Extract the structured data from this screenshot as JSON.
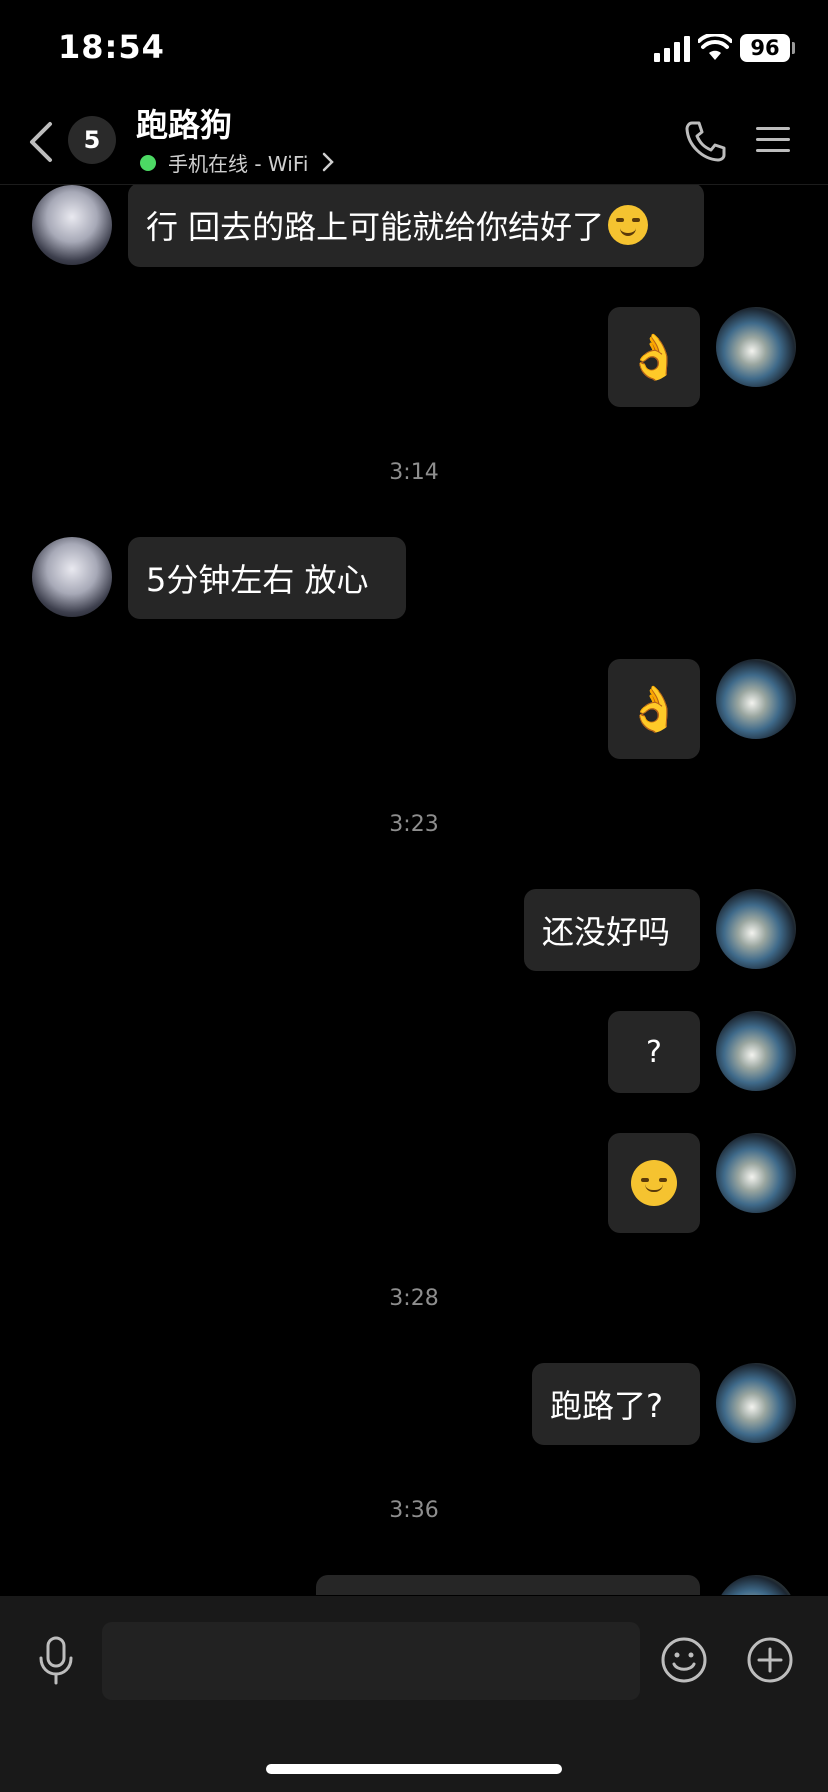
{
  "status_bar": {
    "time": "18:54",
    "battery": "96"
  },
  "header": {
    "back_label": "<",
    "unread_count": "5",
    "title": "跑路狗",
    "online_status": "手机在线 - WiFi"
  },
  "messages": [
    {
      "side": "other",
      "text": "行 回去的路上可能就给你结好了",
      "emoji": "smirk-face"
    },
    {
      "side": "self",
      "emoji": "ok-hand"
    },
    {
      "type": "time",
      "text": "3:14"
    },
    {
      "side": "other",
      "text": "5分钟左右 放心"
    },
    {
      "side": "self",
      "emoji": "ok-hand"
    },
    {
      "type": "time",
      "text": "3:23"
    },
    {
      "side": "self",
      "text": "还没好吗"
    },
    {
      "side": "self",
      "text": "?"
    },
    {
      "side": "self",
      "emoji": "pensive-face"
    },
    {
      "type": "time",
      "text": "3:28"
    },
    {
      "side": "self",
      "text": "跑路了?"
    },
    {
      "type": "time",
      "text": "3:36"
    }
  ],
  "composer": {
    "value": "",
    "placeholder": ""
  },
  "colors": {
    "background": "#000000",
    "bubble": "#262626",
    "online": "#4cd964",
    "timestamp": "#8e8e8e",
    "input_bar": "#191919"
  },
  "icons": [
    "back-chevron-icon",
    "phone-icon",
    "menu-icon",
    "mic-icon",
    "smile-icon",
    "plus-icon",
    "signal-icon",
    "wifi-icon",
    "battery-icon"
  ]
}
